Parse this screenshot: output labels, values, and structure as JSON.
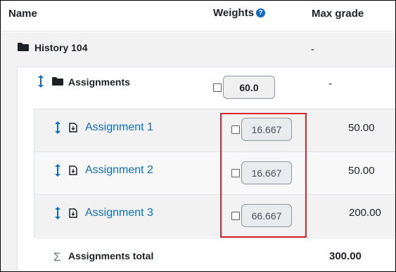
{
  "header": {
    "name": "Name",
    "weights": "Weights",
    "help_icon": "?",
    "max_grade": "Max grade"
  },
  "course": {
    "label": "History 104",
    "max_grade": "-"
  },
  "category": {
    "label": "Assignments",
    "weight": "60.0",
    "max_grade": "-"
  },
  "items": [
    {
      "label": "Assignment 1",
      "weight": "16.667",
      "max_grade": "50.00"
    },
    {
      "label": "Assignment 2",
      "weight": "16.667",
      "max_grade": "50.00"
    },
    {
      "label": "Assignment 3",
      "weight": "66.667",
      "max_grade": "200.00"
    }
  ],
  "total": {
    "label": "Assignments total",
    "max_grade": "300.00"
  },
  "colors": {
    "link": "#0f6cbf",
    "highlight": "#d9232d"
  }
}
